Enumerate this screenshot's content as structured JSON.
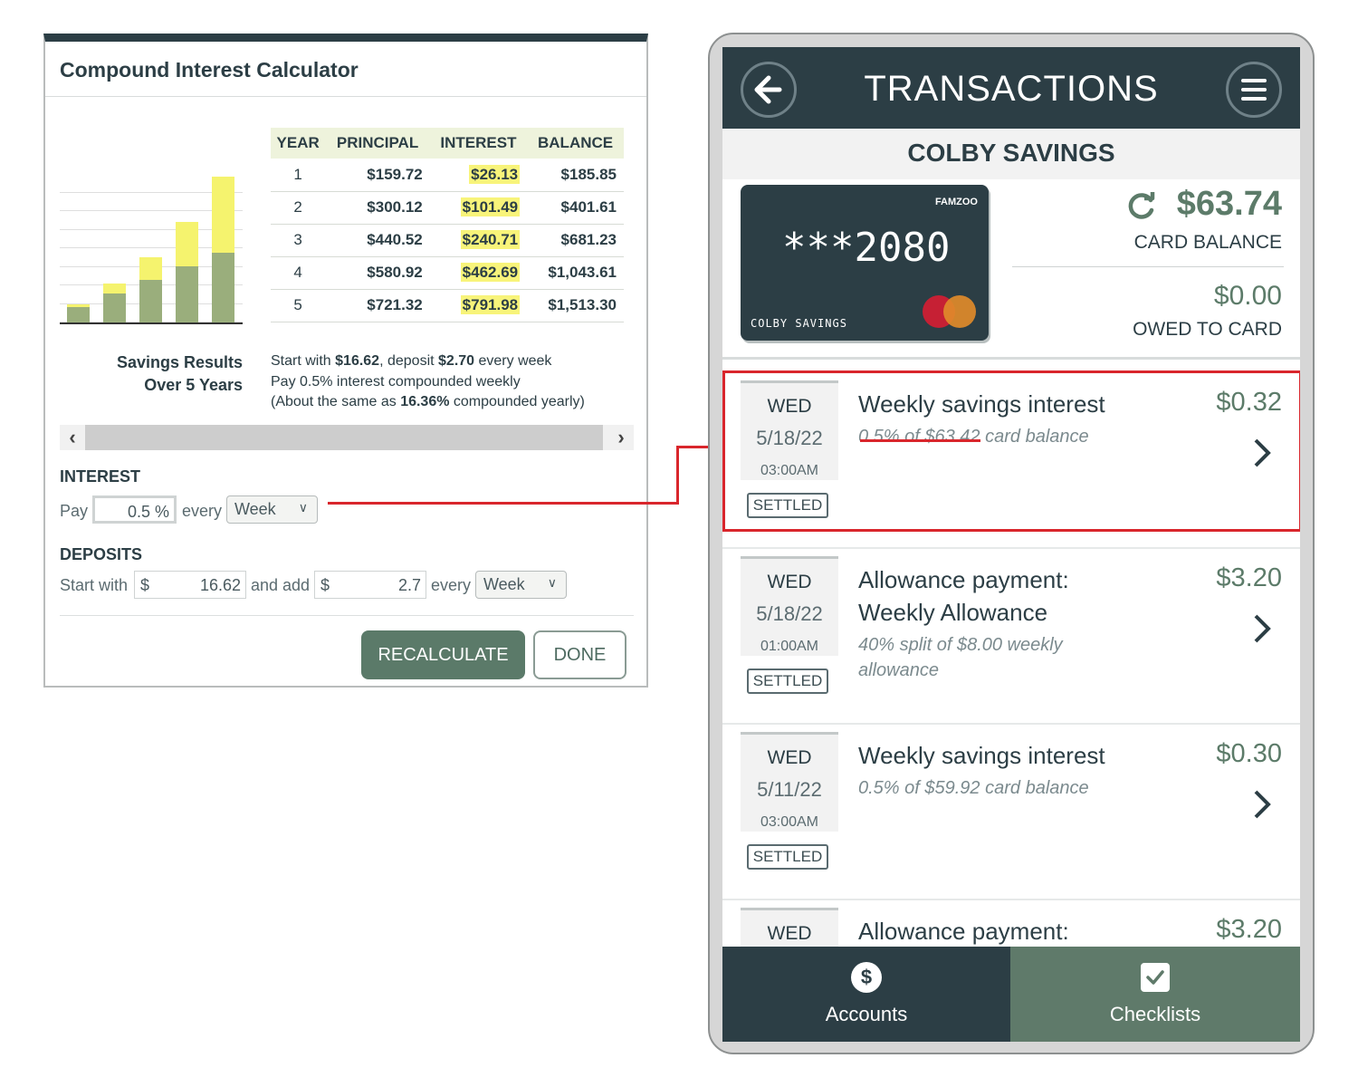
{
  "calculator": {
    "title": "Compound Interest Calculator",
    "table": {
      "headers": [
        "YEAR",
        "PRINCIPAL",
        "INTEREST",
        "BALANCE"
      ],
      "rows": [
        {
          "year": "1",
          "principal": "$159.72",
          "interest": "$26.13",
          "balance": "$185.85"
        },
        {
          "year": "2",
          "principal": "$300.12",
          "interest": "$101.49",
          "balance": "$401.61"
        },
        {
          "year": "3",
          "principal": "$440.52",
          "interest": "$240.71",
          "balance": "$681.23"
        },
        {
          "year": "4",
          "principal": "$580.92",
          "interest": "$462.69",
          "balance": "$1,043.61"
        },
        {
          "year": "5",
          "principal": "$721.32",
          "interest": "$791.98",
          "balance": "$1,513.30"
        }
      ]
    },
    "results": {
      "label_line1": "Savings Results",
      "label_line2": "Over 5 Years",
      "line1_a": "Start with ",
      "line1_b": "$16.62",
      "line1_c": ", deposit ",
      "line1_d": "$2.70",
      "line1_e": " every week",
      "line2": "Pay 0.5% interest compounded weekly",
      "line3_a": "(About the same as ",
      "line3_b": "16.36%",
      "line3_c": " compounded yearly)"
    },
    "scroll": {
      "left_arrow": "‹",
      "right_arrow": "›"
    },
    "interest": {
      "heading": "INTEREST",
      "pay_label": "Pay",
      "rate_value": "0.5 %",
      "every_label": "every",
      "period": "Week"
    },
    "deposits": {
      "heading": "DEPOSITS",
      "start_label": "Start with",
      "currency": "$",
      "start_value": "16.62",
      "add_label": "and add",
      "add_value": "2.7",
      "every_label": "every",
      "period": "Week"
    },
    "buttons": {
      "recalculate": "RECALCULATE",
      "done": "DONE"
    },
    "chart_bars": [
      {
        "principal": 159.72,
        "interest": 26.13
      },
      {
        "principal": 300.12,
        "interest": 101.49
      },
      {
        "principal": 440.52,
        "interest": 240.71
      },
      {
        "principal": 580.92,
        "interest": 462.69
      },
      {
        "principal": 721.32,
        "interest": 791.98
      }
    ],
    "colors": {
      "principal_bar": "#9aae7c",
      "interest_bar": "#f5f36e"
    }
  },
  "phone": {
    "title": "TRANSACTIONS",
    "back_icon": "arrow-left-icon",
    "menu_icon": "hamburger-menu-icon",
    "account_name": "COLBY SAVINGS",
    "card": {
      "brand": "FAMZOO",
      "number": "***2080",
      "holder": "COLBY SAVINGS"
    },
    "card_balance": "$63.74",
    "card_balance_label": "CARD BALANCE",
    "owed": "$0.00",
    "owed_label": "OWED TO CARD",
    "transactions": [
      {
        "dow": "WED",
        "date": "5/18/22",
        "time": "03:00AM",
        "status": "SETTLED",
        "title": "Weekly savings interest",
        "subtitle": "0.5% of $63.42 card balance",
        "amount": "$0.32"
      },
      {
        "dow": "WED",
        "date": "5/18/22",
        "time": "01:00AM",
        "status": "SETTLED",
        "title": "Allowance payment: Weekly Allowance",
        "subtitle": "40% split of $8.00 weekly allowance",
        "amount": "$3.20"
      },
      {
        "dow": "WED",
        "date": "5/11/22",
        "time": "03:00AM",
        "status": "SETTLED",
        "title": "Weekly savings interest",
        "subtitle": "0.5% of $59.92 card balance",
        "amount": "$0.30"
      },
      {
        "dow": "WED",
        "title": "Allowance payment:",
        "amount": "$3.20"
      }
    ],
    "tabs": {
      "accounts": "Accounts",
      "checklists": "Checklists"
    },
    "colors": {
      "header": "#2c3e45",
      "accent": "#5c7b69",
      "highlight": "#d9262c"
    }
  }
}
